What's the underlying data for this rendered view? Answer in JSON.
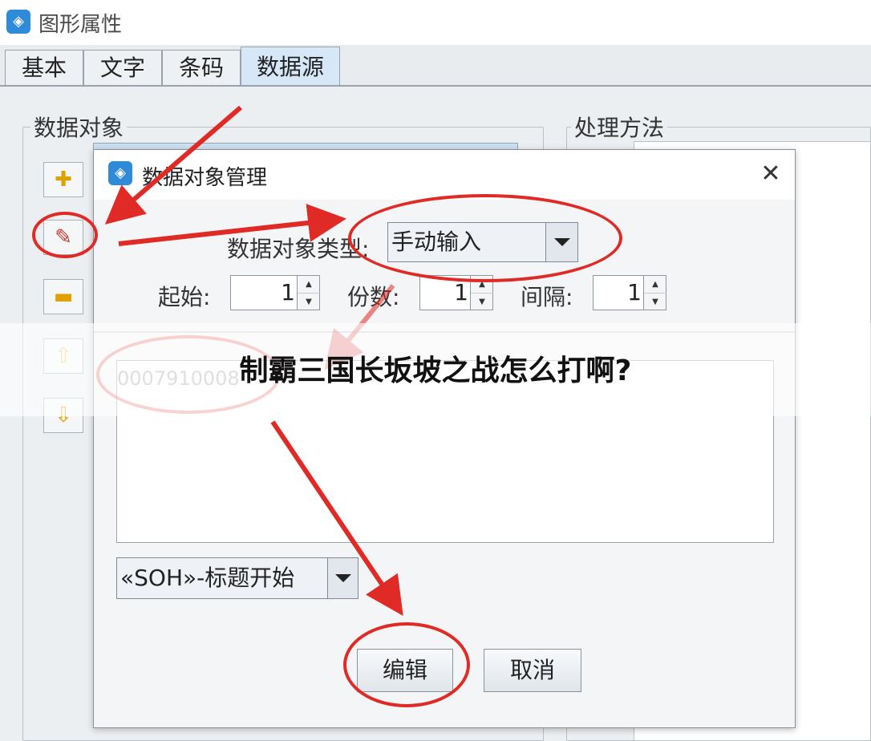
{
  "window": {
    "title": "图形属性"
  },
  "tabs": [
    {
      "label": "基本",
      "active": false
    },
    {
      "label": "文字",
      "active": false
    },
    {
      "label": "条码",
      "active": false
    },
    {
      "label": "数据源",
      "active": true
    }
  ],
  "groups": {
    "data_objects": "数据对象",
    "processing": "处理方法"
  },
  "dialog": {
    "title": "数据对象管理",
    "type_label": "数据对象类型:",
    "type_value": "手动输入",
    "start_label": "起始:",
    "start_value": "1",
    "copies_label": "份数:",
    "copies_value": "1",
    "interval_label": "间隔:",
    "interval_value": "1",
    "list_item": "0007910008",
    "control_combo": "«SOH»-标题开始",
    "edit_button": "编辑",
    "cancel_button": "取消"
  },
  "banner": {
    "text": "制霸三国长坂坡之战怎么打啊?"
  },
  "colors": {
    "annotation": "#e02a26",
    "accent": "#2f8ad8"
  }
}
